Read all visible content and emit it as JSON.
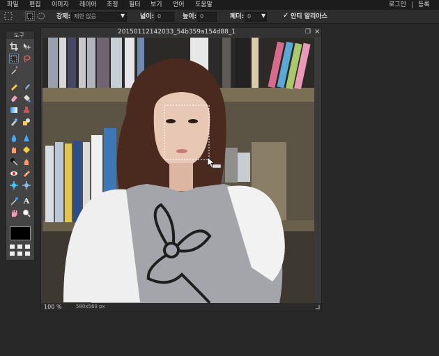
{
  "menu": {
    "items": [
      "파일",
      "편집",
      "이미지",
      "레이어",
      "조정",
      "필터",
      "보기",
      "언어",
      "도움말"
    ],
    "login": "로그인",
    "register": "등록"
  },
  "options": {
    "mode_label": "강제:",
    "mode_value": "제한 없음",
    "width_label": "넓이:",
    "width_value": "0",
    "height_label": "높이:",
    "height_value": "0",
    "feather_label": "페더:",
    "feather_value": "0",
    "antialias_label": "안티 알리아스",
    "antialias_checked": true
  },
  "tools": {
    "title": "도구",
    "icons": [
      "crop-icon",
      "move-icon",
      "marquee-icon",
      "lasso-icon",
      "magic-wand-icon",
      "pencil-icon",
      "brush-icon",
      "eraser-icon",
      "bucket-icon",
      "gradient-icon",
      "stamp-icon",
      "color-replace-icon",
      "drawing-icon",
      "blur-icon",
      "sharpen-icon",
      "smudge-icon",
      "sponge-icon",
      "dodge-icon",
      "burn-icon",
      "redeye-icon",
      "spot-heal-icon",
      "bloat-icon",
      "pinch-icon",
      "color-picker-icon",
      "text-icon",
      "hand-icon",
      "zoom-icon"
    ],
    "foreground_color": "#000000"
  },
  "document": {
    "title": "20150112142033_54b359a154d88_1",
    "zoom": "100",
    "zoom_unit": "%",
    "size": "580x569 px"
  }
}
